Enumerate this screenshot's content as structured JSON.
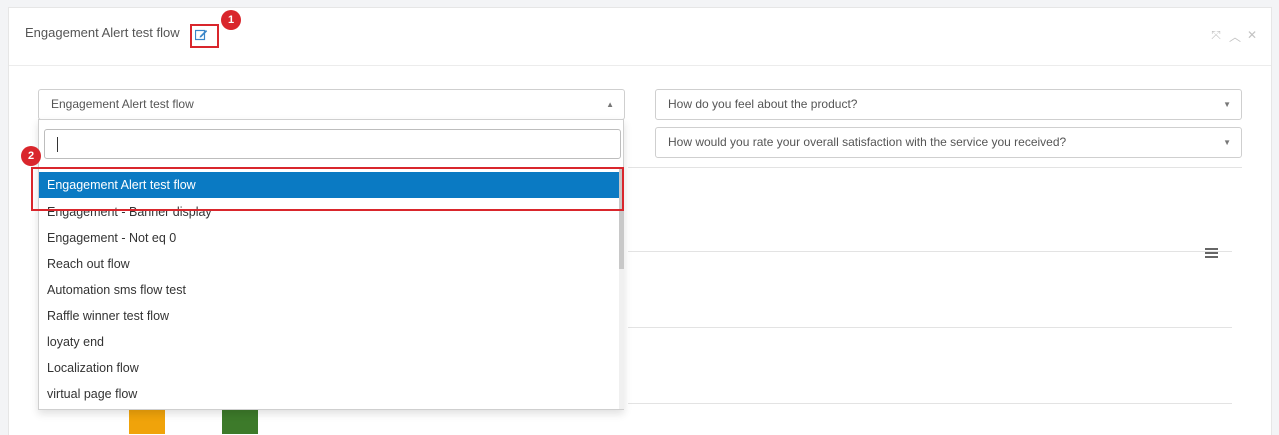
{
  "panel": {
    "title": "Engagement Alert test flow",
    "tools": [
      "expand-icon",
      "collapse-icon",
      "close-icon"
    ]
  },
  "annotations": [
    {
      "number": "1",
      "target": "edit-icon"
    },
    {
      "number": "2",
      "target": "selected-option"
    }
  ],
  "flow_select": {
    "value": "Engagement Alert test flow",
    "search_value": "",
    "options": [
      "Engagement Alert test flow",
      "Engagement - Banner display",
      "Engagement - Not eq 0",
      "Reach out flow",
      "Automation sms flow test",
      "Raffle winner test flow",
      "loyaty end",
      "Localization flow",
      "virtual page flow"
    ],
    "selected_index": 0
  },
  "question_select_1": {
    "value": "How do you feel about the product?"
  },
  "question_select_2": {
    "value": "How would you rate your overall satisfaction with the service you received?"
  },
  "colors": {
    "accent": "#0a7ac3",
    "annotation": "#d9262c",
    "bar_orange": "#f0a30a",
    "bar_green": "#3d7a2a"
  }
}
